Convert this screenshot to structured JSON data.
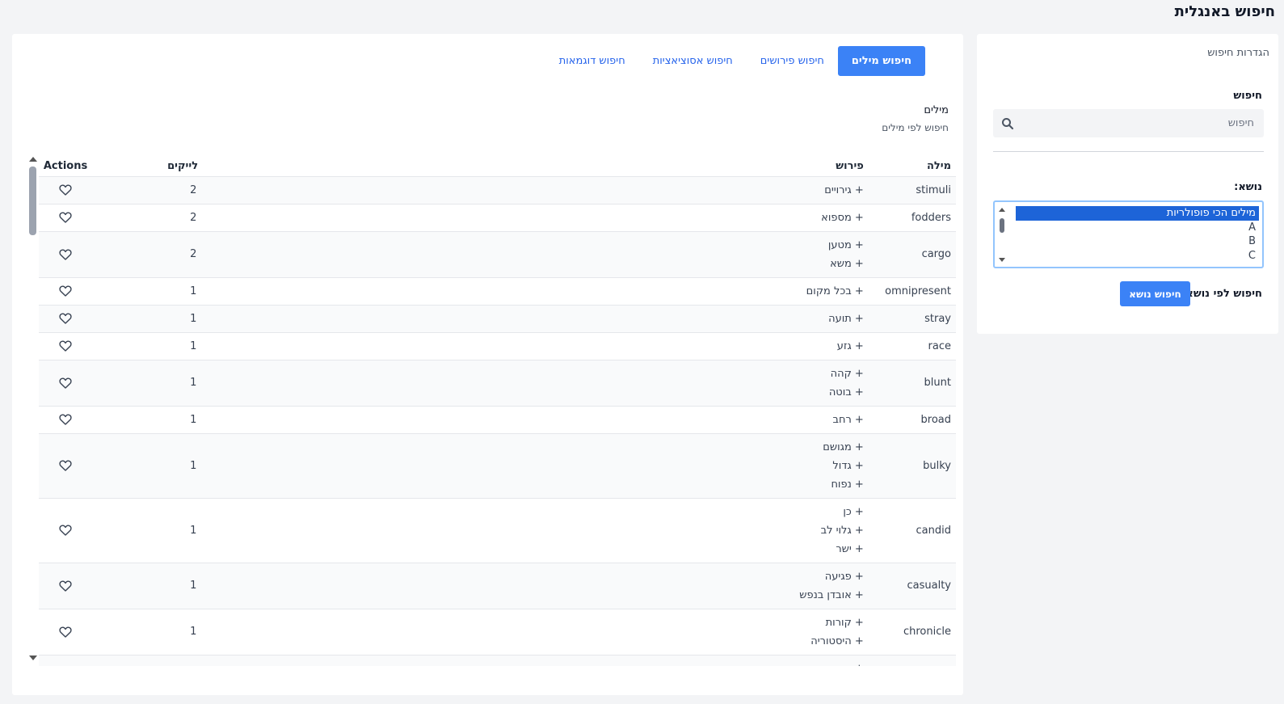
{
  "page": {
    "title": "חיפוש באנגלית"
  },
  "settings": {
    "title": "הגדרות חיפוש",
    "search_label": "חיפוש",
    "search_placeholder": "חיפוש",
    "topic_label": "נושא:",
    "topic_options": [
      "מילים הכי פופולריות",
      "A",
      "B",
      "C"
    ],
    "topic_selected_index": 0,
    "topic_search_label": "חיפוש לפי נושא",
    "topic_search_button": "חיפוש נושא"
  },
  "tabs": [
    {
      "label": "חיפוש מילים",
      "active": true
    },
    {
      "label": "חיפוש פירושים",
      "active": false
    },
    {
      "label": "חיפוש אסוציאציות",
      "active": false
    },
    {
      "label": "חיפוש דוגמאות",
      "active": false
    }
  ],
  "section": {
    "title": "מילים",
    "subtitle": "חיפוש לפי מילים"
  },
  "table": {
    "headers": {
      "word": "מילה",
      "meaning": "פירוש",
      "likes": "לייקים",
      "actions": "Actions"
    },
    "rows": [
      {
        "word": "stimuli",
        "meanings": [
          "+ גירויים"
        ],
        "likes": "2"
      },
      {
        "word": "fodders",
        "meanings": [
          "+ מספוא"
        ],
        "likes": "2"
      },
      {
        "word": "cargo",
        "meanings": [
          "+ מטען",
          "+ משא"
        ],
        "likes": "2"
      },
      {
        "word": "omnipresent",
        "meanings": [
          "+ בכל מקום"
        ],
        "likes": "1"
      },
      {
        "word": "stray",
        "meanings": [
          "+ תועה"
        ],
        "likes": "1"
      },
      {
        "word": "race",
        "meanings": [
          "+ גזע"
        ],
        "likes": "1"
      },
      {
        "word": "blunt",
        "meanings": [
          "+ קהה",
          "+ בוטה"
        ],
        "likes": "1"
      },
      {
        "word": "broad",
        "meanings": [
          "+ רחב"
        ],
        "likes": "1"
      },
      {
        "word": "bulky",
        "meanings": [
          "+ מגושם",
          "+ גדול",
          "+ נפוח"
        ],
        "likes": "1"
      },
      {
        "word": "candid",
        "meanings": [
          "+ כן",
          "+ גלוי לב",
          "+ ישר"
        ],
        "likes": "1"
      },
      {
        "word": "casualty",
        "meanings": [
          "+ פגיעה",
          "+ אובדן בנפש"
        ],
        "likes": "1"
      },
      {
        "word": "chronicle",
        "meanings": [
          "+ קורות",
          "+ היסטוריה"
        ],
        "likes": "1"
      },
      {
        "word": "",
        "meanings": [
          "+ גס"
        ],
        "likes": ""
      }
    ]
  },
  "icons": {
    "search": "search-icon",
    "like": "heart-icon"
  },
  "colors": {
    "accent": "#3b82f6",
    "selected_option": "#1d64d8",
    "link": "#2563eb"
  }
}
